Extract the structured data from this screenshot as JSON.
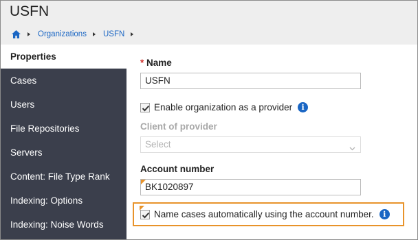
{
  "header": {
    "title": "USFN",
    "breadcrumb": [
      {
        "label": "Organizations"
      },
      {
        "label": "USFN"
      }
    ]
  },
  "sidebar": {
    "items": [
      {
        "label": "Properties"
      },
      {
        "label": "Cases"
      },
      {
        "label": "Users"
      },
      {
        "label": "File Repositories"
      },
      {
        "label": "Servers"
      },
      {
        "label": "Content: File Type Rank"
      },
      {
        "label": "Indexing: Options"
      },
      {
        "label": "Indexing: Noise Words"
      }
    ],
    "active_item": "Properties"
  },
  "form": {
    "name": {
      "required_mark": "*",
      "label": "Name",
      "value": "USFN"
    },
    "enable_provider": {
      "label": "Enable organization as a provider",
      "checked": true,
      "info_icon": "info-icon"
    },
    "client_of_provider": {
      "label": "Client of provider",
      "placeholder": "Select",
      "disabled": true
    },
    "account_number": {
      "label": "Account number",
      "value": "BK1020897"
    },
    "name_cases_auto": {
      "label": "Name cases automatically using the account number.",
      "checked": true,
      "info_icon": "info-icon"
    }
  },
  "colors": {
    "sidebar_bg": "#3b3f4c",
    "link": "#1a66c4",
    "highlight": "#e8932a",
    "required": "#d0312d"
  }
}
